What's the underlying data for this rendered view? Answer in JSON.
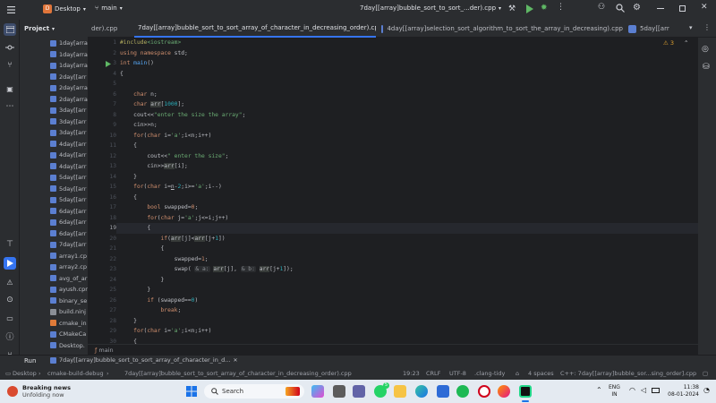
{
  "titlebar": {
    "project": "Desktop",
    "branch": "main",
    "run_config": "7day[[array]bubble_sort_to_sort_...der).cpp"
  },
  "project_panel": {
    "title": "Project",
    "items": [
      "1day[arra",
      "1day[arra",
      "1day[arra",
      "2day[[arr",
      "2day[arra",
      "2day[arra",
      "3day[[arr",
      "3day[[arr",
      "3day[[arr",
      "4day[[arr",
      "4day[[arr",
      "4day[[arr",
      "5day[[arr",
      "5day[[arr",
      "5day[[arr",
      "6day[[arr",
      "6day[[arr",
      "6day[[arr",
      "7day[[arr",
      "array1.cp",
      "array2.cp",
      "avg_of_ar",
      "ayush.cpr",
      "binary_se",
      "build.ninj",
      "cmake_in",
      "CMakeCa",
      "Desktop."
    ]
  },
  "tabs": [
    {
      "label": "der).cpp"
    },
    {
      "label": "7day[[array]bubble_sort_to_sort_array_of_character_in_decreasing_order).cpp"
    },
    {
      "label": "4day[[array]selection_sort_algorithm_to_sort_the_array_in_decreasing).cpp"
    },
    {
      "label": "5day[[arr"
    }
  ],
  "editor": {
    "warnings": "3",
    "line_numbers": [
      "1",
      "2",
      "3",
      "4",
      "5",
      "6",
      "7",
      "8",
      "9",
      "10",
      "11",
      "12",
      "13",
      "14",
      "15",
      "16",
      "17",
      "18",
      "19",
      "20",
      "21",
      "22",
      "23",
      "24",
      "25",
      "26",
      "27",
      "28",
      "29",
      "30"
    ],
    "breadcrumb": "main"
  },
  "runbar": {
    "label": "Run",
    "config": "7day[[array]bubble_sort_to_sort_array_of_character_in_d..."
  },
  "statusbar": {
    "crumbs": [
      "Desktop",
      "cmake-build-debug",
      "7day[[array]bubble_sort_to_sort_array_of_character_in_decreasing_order).cpp"
    ],
    "position": "19:23",
    "line_sep": "CRLF",
    "encoding": "UTF-8",
    "linter": ".clang-tidy",
    "indent": "4 spaces",
    "context": "C++: 7day[[array]bubble_sor...sing_order].cpp"
  },
  "taskbar": {
    "news_title": "Breaking news",
    "news_sub": "Unfolding now",
    "search": "Search",
    "lang": "ENG",
    "region": "IN",
    "time": "11:38",
    "date": "08-01-2024",
    "badge": "5"
  }
}
